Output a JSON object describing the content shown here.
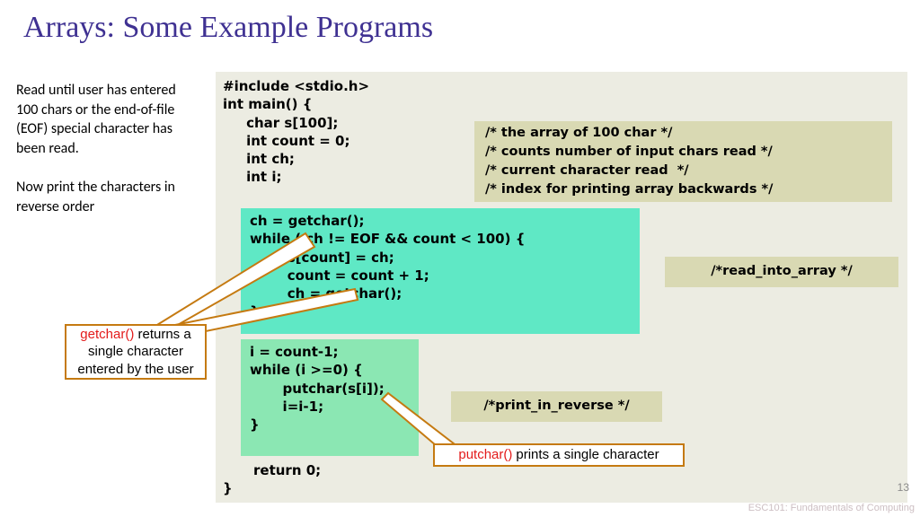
{
  "title": "Arrays: Some Example Programs",
  "desc": {
    "p1": "Read until user has entered 100 chars or the end-of-file (EOF) special character has been read.",
    "p2": "Now print the characters in reverse order"
  },
  "code": {
    "top": "#include <stdio.h>\nint main() {\n     char s[100];\n     int count = 0;\n     int ch;\n     int i;",
    "comments": "/* the array of 100 char */\n/* counts number of input chars read */\n/* current character read  */\n/* index for printing array backwards */",
    "read_block": "ch = getchar();\nwhile ( ch != EOF && count < 100) {\n        s[count] = ch;\n        count = count + 1;\n        ch = getchar();\n}",
    "note_read": "/*read_into_array */",
    "print_block": "i = count-1;\nwhile (i >=0) {\n       putchar(s[i]);\n       i=i-1;\n}",
    "note_print": "/*print_in_reverse */",
    "bottom": "return 0;",
    "close": "}"
  },
  "callouts": {
    "getchar_fn": "getchar()",
    "getchar_txt": " returns a single character entered by the user",
    "putchar_fn": "putchar()",
    "putchar_txt": " prints a single character"
  },
  "page": "13",
  "footer": "ESC101: Fundamentals\nof Computing"
}
